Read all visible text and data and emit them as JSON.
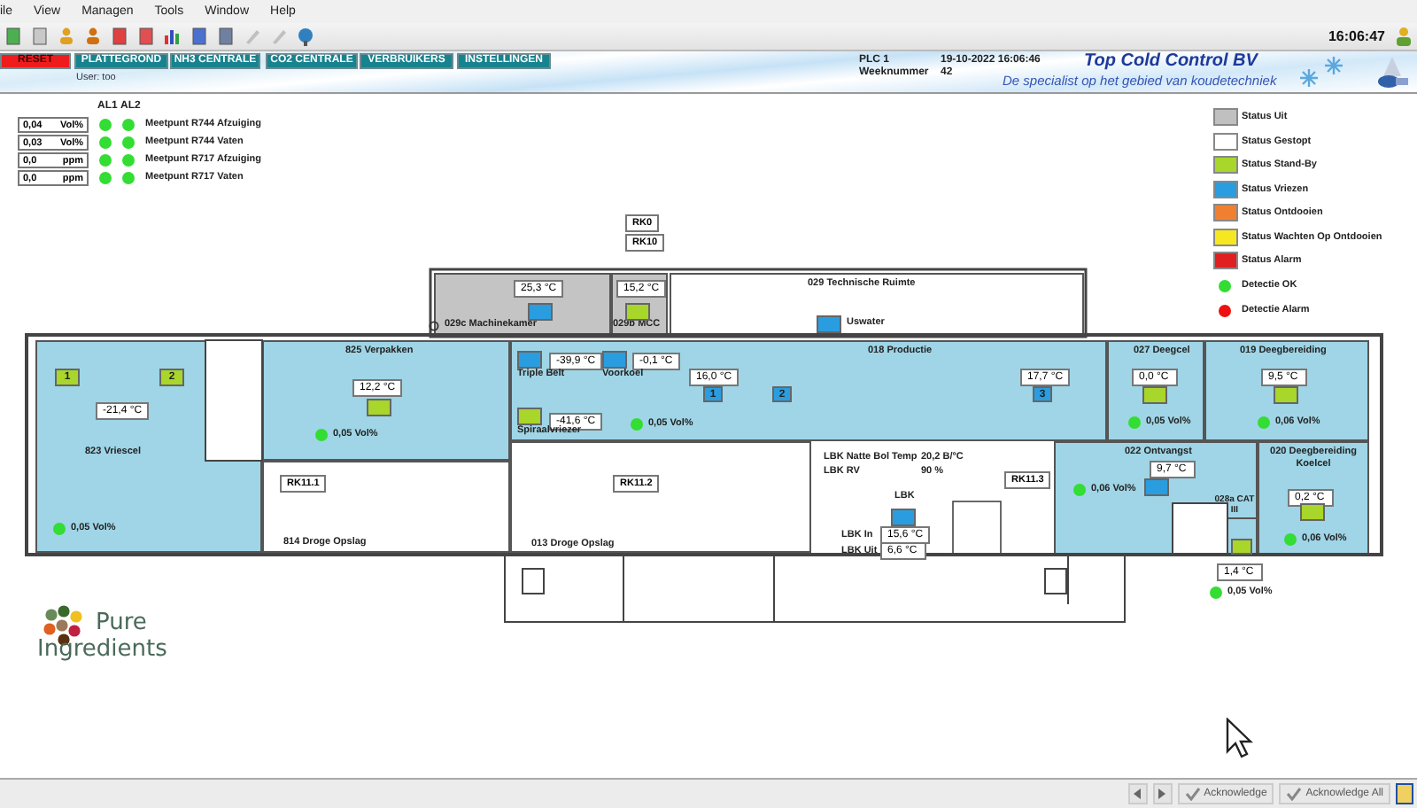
{
  "menu": [
    "ile",
    "View",
    "Managen",
    "Tools",
    "Window",
    "Help"
  ],
  "clock": "16:06:47",
  "nav_tabs": [
    {
      "label": "RESET",
      "kind": "reset"
    },
    {
      "label": "PLATTEGROND",
      "kind": "tab"
    },
    {
      "label": "NH3 CENTRALE",
      "kind": "tab"
    },
    {
      "label": "CO2 CENTRALE",
      "kind": "tab"
    },
    {
      "label": "VERBRUIKERS",
      "kind": "tab"
    },
    {
      "label": "INSTELLINGEN",
      "kind": "tab"
    }
  ],
  "user": "User: too",
  "header": {
    "plc": "PLC 1",
    "datetime": "19-10-2022 16:06:46",
    "week_label": "Weeknummer",
    "week": "42",
    "company": "Top Cold Control BV",
    "slogan": "De specialist op het gebied van koudetechniek"
  },
  "alarm_columns": [
    "AL1",
    "AL2"
  ],
  "measurements": [
    {
      "value": "0,04",
      "unit": "Vol%",
      "label": "Meetpunt R744 Afzuiging",
      "alarms": [
        {
          "color": "#33dd33"
        },
        {
          "color": "#33dd33"
        }
      ]
    },
    {
      "value": "0,03",
      "unit": "Vol%",
      "label": "Meetpunt R744 Vaten",
      "alarms": [
        {
          "color": "#33dd33"
        },
        {
          "color": "#33dd33"
        }
      ]
    },
    {
      "value": "0,0",
      "unit": "ppm",
      "label": "Meetpunt R717 Afzuiging",
      "alarms": [
        {
          "color": "#33dd33"
        },
        {
          "color": "#33dd33"
        }
      ]
    },
    {
      "value": "0,0",
      "unit": "ppm",
      "label": "Meetpunt R717 Vaten",
      "alarms": [
        {
          "color": "#33dd33"
        },
        {
          "color": "#33dd33"
        }
      ]
    }
  ],
  "legend": [
    {
      "label": "Status Uit",
      "color": "#c0c0c0",
      "kind": "square"
    },
    {
      "label": "Status Gestopt",
      "color": "#ffffff",
      "kind": "square"
    },
    {
      "label": "Status Stand-By",
      "color": "#a8d62a",
      "kind": "square"
    },
    {
      "label": "Status Vriezen",
      "color": "#2a9de0",
      "kind": "square"
    },
    {
      "label": "Status Ontdooien",
      "color": "#f08030",
      "kind": "square"
    },
    {
      "label": "Status Wachten Op Ontdooien",
      "color": "#f5e820",
      "kind": "square"
    },
    {
      "label": "Status Alarm",
      "color": "#e02020",
      "kind": "square"
    },
    {
      "label": "Detectie OK",
      "color": "#33dd33",
      "kind": "dot"
    },
    {
      "label": "Detectie Alarm",
      "color": "#ee1111",
      "kind": "dot"
    }
  ],
  "floor_plan": {
    "rooms": [
      {
        "name": "823 Vriescel",
        "kind": "cooled"
      },
      {
        "name": "825 Verpakken",
        "kind": "cooled"
      },
      {
        "name": "814 Droge Opslag",
        "kind": "plain"
      },
      {
        "name": "029c Machinekamer",
        "kind": "machine"
      },
      {
        "name": "029b MCC",
        "kind": "machine"
      },
      {
        "name": "029 Technische Ruimte",
        "kind": "plain"
      },
      {
        "name": "018 Productie",
        "kind": "cooled"
      },
      {
        "name": "027 Deegcel",
        "kind": "cooled"
      },
      {
        "name": "019 Deegbereiding",
        "kind": "cooled"
      },
      {
        "name": "013 Droge Opslag",
        "kind": "plain"
      },
      {
        "name": "022 Ontvangst",
        "kind": "cooled"
      },
      {
        "name": "020 Deegbereiding Koelcel",
        "kind": "cooled"
      },
      {
        "name": "028a CAT III",
        "kind": "cooled"
      }
    ],
    "tags": [
      "RK0",
      "RK10",
      "RK11.1",
      "RK11.2",
      "RK11.3"
    ],
    "temperatures": [
      "-21,4 °C",
      "12,2 °C",
      "25,3 °C",
      "15,2 °C",
      "-39,9 °C",
      "-0,1 °C",
      "16,0 °C",
      "17,7 °C",
      "-41,6 °C",
      "0,0 °C",
      "9,5 °C",
      "9,7 °C",
      "0,2 °C",
      "1,4 °C"
    ],
    "units": [
      {
        "label": "1",
        "color": "#a8d62a"
      },
      {
        "label": "2",
        "color": "#a8d62a"
      },
      {
        "color": "#a8d62a"
      },
      {
        "color": "#2a9de0"
      },
      {
        "color": "#a8d62a"
      },
      {
        "color": "#2a9de0"
      },
      {
        "color": "#2a9de0"
      },
      {
        "color": "#2a9de0"
      },
      {
        "label": "1",
        "color": "#2a9de0"
      },
      {
        "label": "2",
        "color": "#2a9de0"
      },
      {
        "label": "3",
        "color": "#2a9de0"
      },
      {
        "color": "#a8d62a"
      },
      {
        "color": "#a8d62a"
      },
      {
        "color": "#a8d62a"
      },
      {
        "color": "#2a9de0"
      },
      {
        "color": "#a8d62a"
      },
      {
        "color": "#a8d62a"
      },
      {
        "color": "#2a9de0"
      }
    ],
    "unit_labels": [
      "Triple Belt",
      "Voorkoel",
      "Spiraalvriezer",
      "Uswater",
      "LBK"
    ],
    "detections": [
      {
        "reading": "0,05 Vol%",
        "color": "#33dd33"
      },
      {
        "reading": "0,05 Vol%",
        "color": "#33dd33"
      },
      {
        "reading": "0,05 Vol%",
        "color": "#33dd33"
      },
      {
        "reading": "0,05 Vol%",
        "color": "#33dd33"
      },
      {
        "reading": "0,06 Vol%",
        "color": "#33dd33"
      },
      {
        "reading": "0,06 Vol%",
        "color": "#33dd33"
      },
      {
        "reading": "0,06 Vol%",
        "color": "#33dd33"
      },
      {
        "reading": "0,05 Vol%",
        "color": "#33dd33"
      }
    ],
    "lbk_readings": [
      {
        "label": "LBK Natte Bol Temp",
        "value": "20,2 B/°C",
        "kind": "plain"
      },
      {
        "label": "LBK RV",
        "value": "90 %",
        "kind": "plain"
      },
      {
        "label": "LBK In",
        "value": "15,6 °C",
        "kind": "boxed"
      },
      {
        "label": "LBK Uit",
        "value": "6,6 °C",
        "kind": "boxed"
      }
    ]
  },
  "logo_lines": [
    "Pure",
    "Ingredients"
  ],
  "status_bar": {
    "buttons": [
      "Acknowledge",
      "Acknowledge All"
    ]
  }
}
